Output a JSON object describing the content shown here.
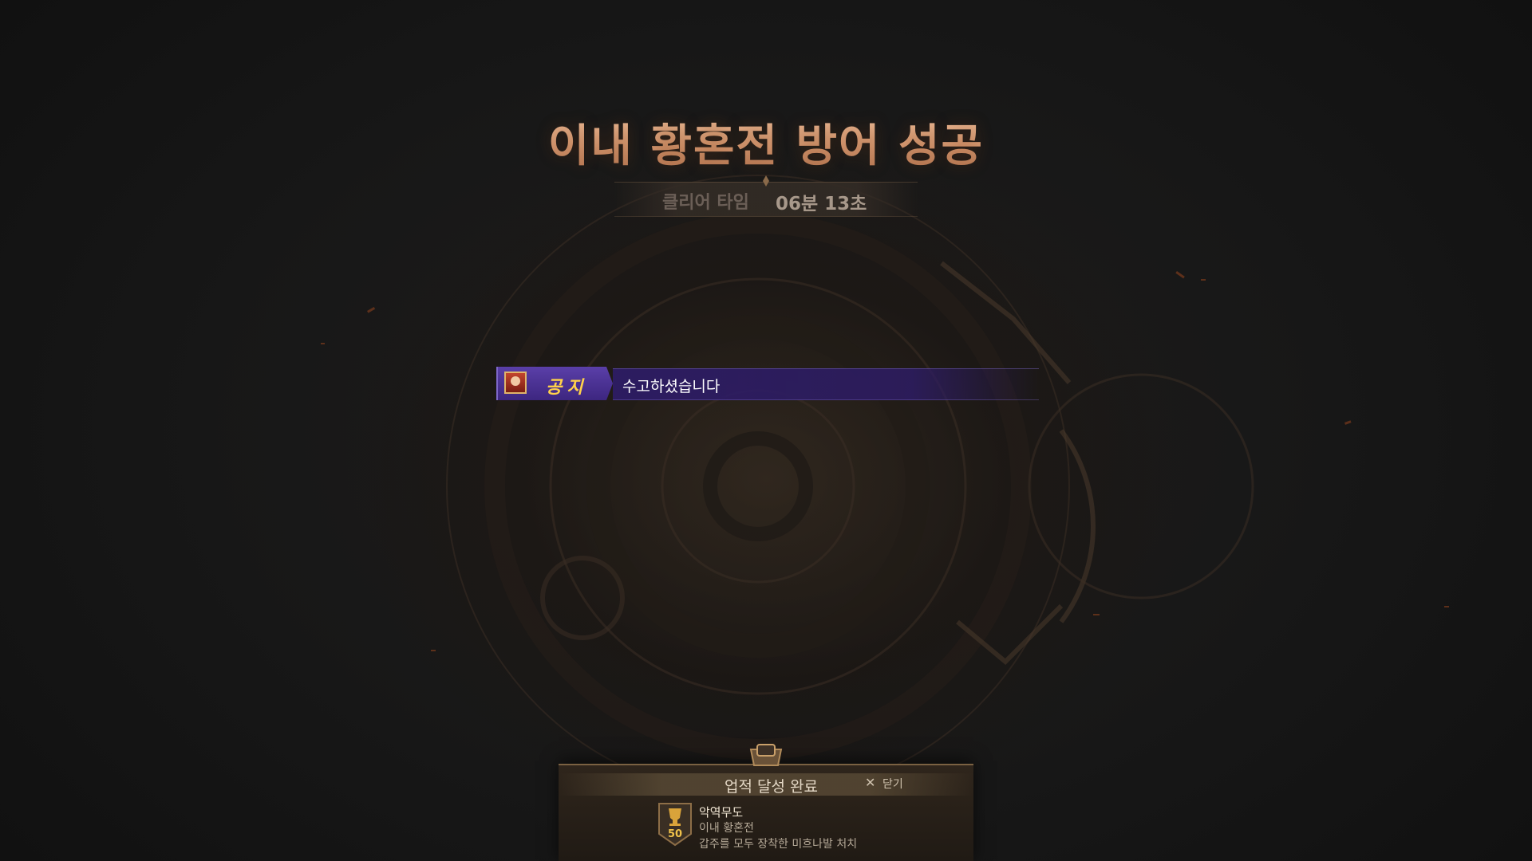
{
  "result": {
    "title": "이내 황혼전 방어 성공",
    "clear_time_label": "클리어 타임",
    "clear_time_value": "06분 13초"
  },
  "notice": {
    "tag": "공지",
    "message": "수고하셨습니다",
    "portrait_icon": "character-portrait-icon",
    "accent_color": "#4a2f96",
    "tag_text_color": "#ffd24a"
  },
  "achievement": {
    "header": "업적 달성 완료",
    "close_label": "닫기",
    "close_icon": "close-x-icon",
    "badge_icon": "trophy-icon",
    "points": "50",
    "name": "악역무도",
    "category": "이내 황혼전",
    "description": "갑주를 모두 장착한 미흐나발 처치"
  },
  "colors": {
    "title": "#d9a07c",
    "background": "#161616",
    "panel": "#2a2219"
  }
}
